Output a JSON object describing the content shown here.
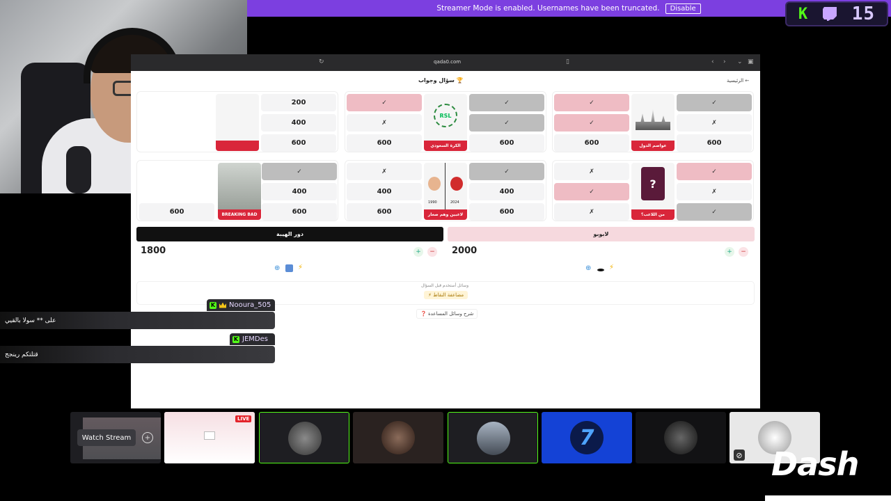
{
  "banner": {
    "text": "Streamer Mode is enabled. Usernames have been truncated.",
    "button": "Disable"
  },
  "badge": {
    "k": "K",
    "num": "15"
  },
  "browser": {
    "url": "qada0.com",
    "title": "سؤال وجواب 🏆",
    "home": "الرئيسية ←"
  },
  "categories": [
    {
      "label": "",
      "values": [
        "200",
        "400",
        "600"
      ]
    },
    {
      "label": "الكرة السعودي",
      "logo": "RSL",
      "values": [
        "600",
        "600"
      ]
    },
    {
      "label": "عواصم الدول",
      "values": [
        "600",
        "600"
      ]
    },
    {
      "label": "BREAKING BAD",
      "values": [
        "600",
        "400",
        "600"
      ]
    },
    {
      "label": "لاعبين وهم صغار",
      "years": [
        "1990",
        "2024"
      ],
      "values": [
        "400",
        "600",
        "400",
        "600"
      ]
    },
    {
      "label": "من اللاعب؟",
      "qmark": "?"
    }
  ],
  "marks": {
    "check": "✓",
    "cross": "✗"
  },
  "teams": [
    {
      "name": "دور الهيبة",
      "score": "1800"
    },
    {
      "name": "لابوبو",
      "score": "2000"
    }
  ],
  "help": {
    "caption": "وسائل أستخدم قبل السؤال",
    "double": "⚡ مضاعفة النقاط",
    "explain": "❓ شرح وسائل المساعدة"
  },
  "chat": [
    {
      "user": "Nooura_505",
      "message": "على ** سولا بالقيي"
    },
    {
      "user": "JEMDes",
      "message": "قتلتكم رينجج"
    }
  ],
  "tiles": {
    "watch": "Watch Stream",
    "live": "LIVE"
  },
  "logo": "Dash"
}
